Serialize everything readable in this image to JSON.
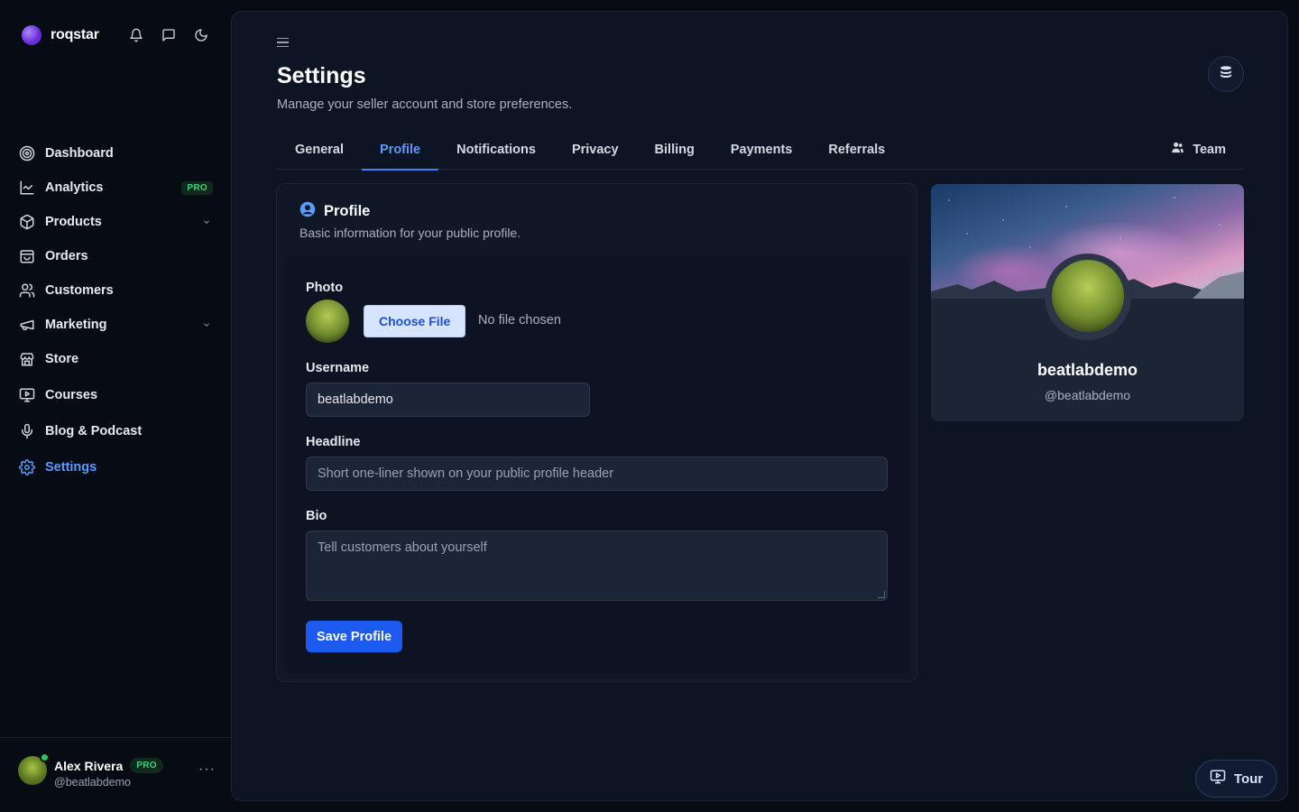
{
  "brand": {
    "name": "roqstar"
  },
  "topbar": {
    "icons": [
      "bell-icon",
      "message-icon",
      "moon-icon"
    ]
  },
  "nav": {
    "items": [
      {
        "label": "Dashboard",
        "icon": "target-icon"
      },
      {
        "label": "Analytics",
        "icon": "chart-icon",
        "badge": "PRO"
      },
      {
        "label": "Products",
        "icon": "box-icon",
        "expandable": true
      },
      {
        "label": "Orders",
        "icon": "bag-icon"
      },
      {
        "label": "Customers",
        "icon": "users-icon"
      },
      {
        "label": "Marketing",
        "icon": "megaphone-icon",
        "expandable": true
      },
      {
        "label": "Store",
        "icon": "store-icon"
      },
      {
        "label": "Courses",
        "icon": "presentation-icon"
      },
      {
        "label": "Blog & Podcast",
        "icon": "mic-icon"
      },
      {
        "label": "Settings",
        "icon": "gear-icon",
        "active": true
      }
    ]
  },
  "user": {
    "name": "Alex Rivera",
    "badge": "PRO",
    "handle": "@beatlabdemo",
    "more": "···"
  },
  "page": {
    "title": "Settings",
    "subtitle": "Manage your seller account and store preferences."
  },
  "tabs": {
    "items": [
      "General",
      "Profile",
      "Notifications",
      "Privacy",
      "Billing",
      "Payments",
      "Referrals"
    ],
    "active": "Profile",
    "team_label": "Team"
  },
  "profile_card": {
    "title": "Profile",
    "subtitle": "Basic information for your public profile.",
    "photo_label": "Photo",
    "choose_file_label": "Choose File",
    "no_file_text": "No file chosen",
    "username_label": "Username",
    "username_value": "beatlabdemo",
    "headline_label": "Headline",
    "headline_placeholder": "Short one-liner shown on your public profile header",
    "bio_label": "Bio",
    "bio_placeholder": "Tell customers about yourself",
    "save_label": "Save Profile"
  },
  "preview": {
    "name": "beatlabdemo",
    "handle": "@beatlabdemo"
  },
  "tour": {
    "label": "Tour"
  },
  "colors": {
    "accent": "#3b82f6",
    "active_text": "#5a9bff",
    "pro_badge": "#34d27b",
    "primary_button": "#1d5bf0"
  }
}
